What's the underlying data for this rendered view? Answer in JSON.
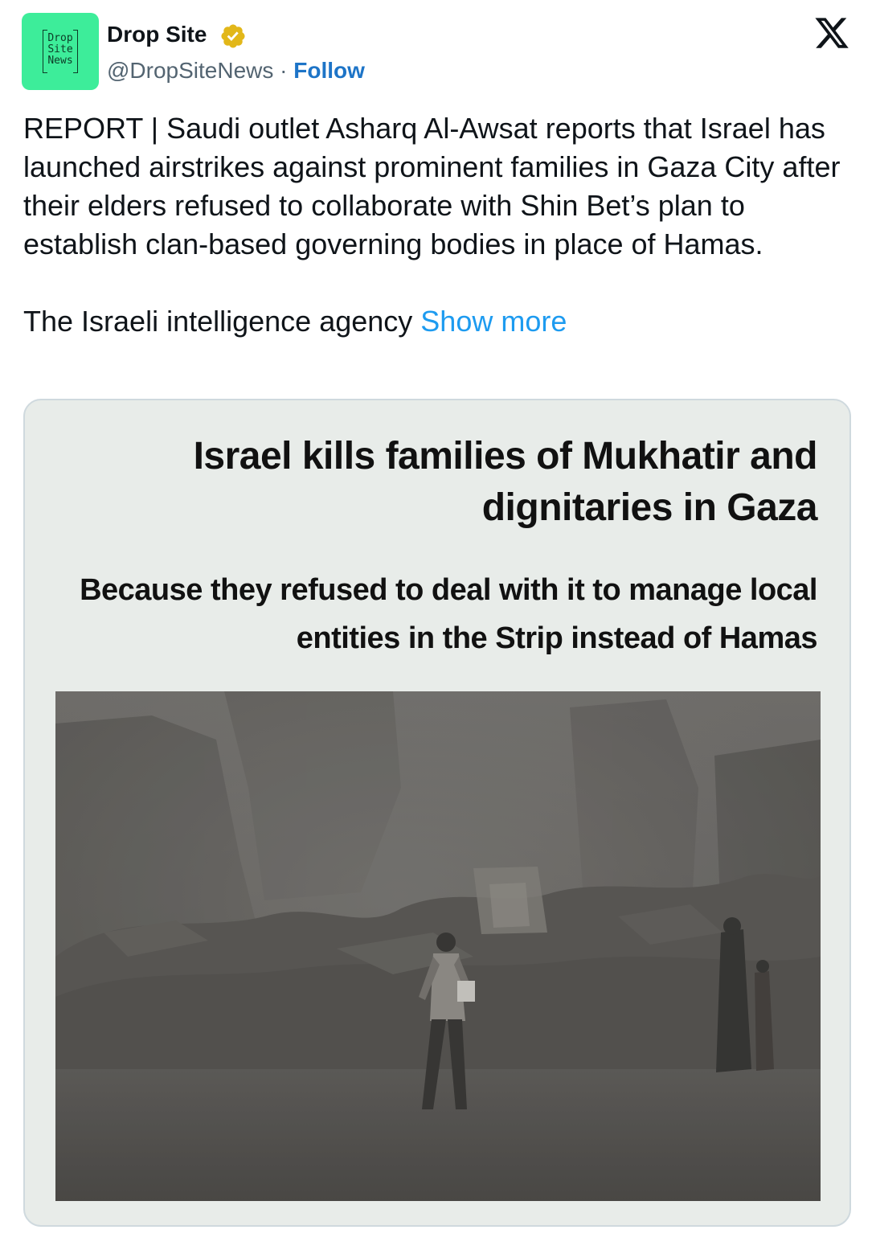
{
  "author": {
    "display_name": "Drop Site",
    "handle": "@DropSiteNews",
    "separator": "·",
    "follow_label": "Follow",
    "avatar_logo_lines": [
      "Drop",
      "Site",
      "News"
    ],
    "verified_badge_color": "#e2b719",
    "avatar_color": "#3ded9a"
  },
  "platform": {
    "logo_icon": "x-logo-icon"
  },
  "tweet": {
    "paragraph_1": "REPORT | Saudi outlet Asharq Al-Awsat reports that Israel has launched airstrikes against prominent families in Gaza City after their elders refused to collaborate with Shin Bet’s plan to establish clan-based governing bodies in place of Hamas.",
    "paragraph_2": "The Israeli intelligence agency",
    "show_more_label": "Show more",
    "link_color": "#1d9bf0"
  },
  "media_card": {
    "headline": "Israel kills families of Mukhatir and dignitaries in Gaza",
    "subheadline": "Because they refused to deal with it to manage local entities in the Strip instead of Hamas",
    "photo_subject": "rubble-street-photo"
  }
}
